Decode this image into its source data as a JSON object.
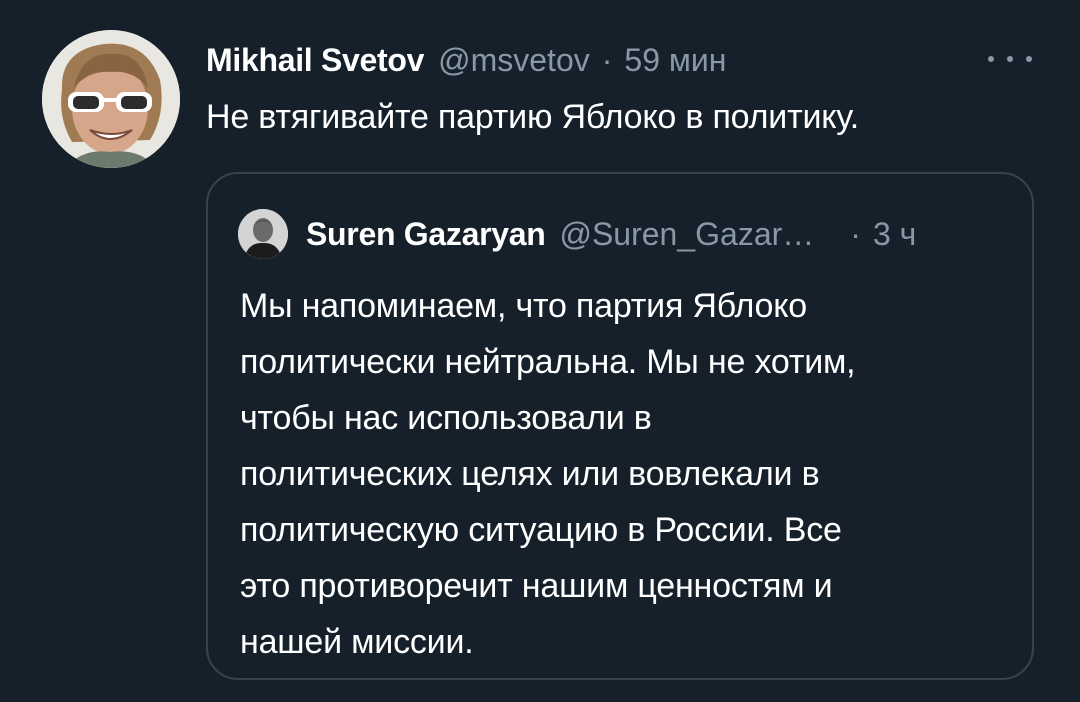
{
  "tweet": {
    "author_name": "Mikhail Svetov",
    "author_handle": "@msvetov",
    "separator": "·",
    "time": "59 мин",
    "text": "Не втягивайте партию Яблоко в политику.",
    "avatar_icon": "user-avatar-sunglasses"
  },
  "quote": {
    "author_name": "Suren Gazaryan",
    "author_handle": "@Suren_Gazar…",
    "separator": "·",
    "time": "3 ч",
    "avatar_icon": "user-avatar",
    "lines": [
      "Мы напоминаем, что партия Яблоко",
      "политически нейтральна. Мы не хотим,",
      "чтобы нас использовали в",
      "политических целях или вовлекали в",
      "политическую ситуацию в России. Все",
      "это противоречит нашим ценностям и",
      "нашей миссии."
    ]
  },
  "colors": {
    "background": "#15202b",
    "border": "#38444d",
    "secondary_text": "#8899a6",
    "primary_text": "#ffffff"
  }
}
